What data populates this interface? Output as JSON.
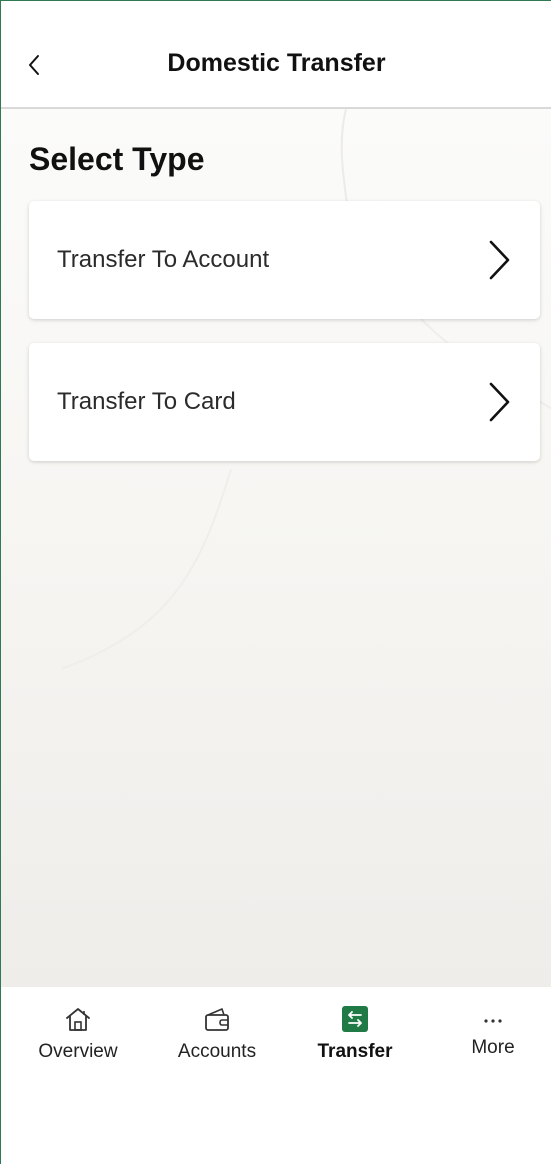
{
  "header": {
    "title": "Domestic Transfer",
    "back_icon": "chevron-left-icon"
  },
  "main": {
    "section_title": "Select Type",
    "options": [
      {
        "label": "Transfer To Account",
        "icon": "chevron-right-icon"
      },
      {
        "label": "Transfer To Card",
        "icon": "chevron-right-icon"
      }
    ]
  },
  "tabbar": {
    "items": [
      {
        "label": "Overview",
        "icon": "home-icon",
        "active": false
      },
      {
        "label": "Accounts",
        "icon": "wallet-icon",
        "active": false
      },
      {
        "label": "Transfer",
        "icon": "transfer-icon",
        "active": true
      },
      {
        "label": "More",
        "icon": "more-icon",
        "active": false
      }
    ],
    "accent_color": "#1f7a46"
  }
}
